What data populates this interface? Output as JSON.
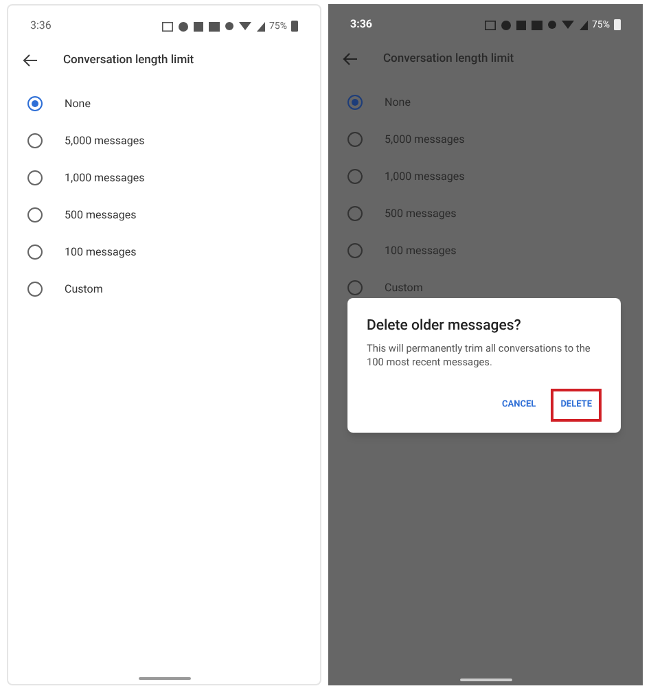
{
  "screens": [
    {
      "dimmed": false,
      "status_bar": {
        "time": "3:36",
        "battery": "75%"
      },
      "title": "Conversation length limit",
      "options": [
        {
          "label": "None",
          "selected": true
        },
        {
          "label": "5,000 messages",
          "selected": false
        },
        {
          "label": "1,000 messages",
          "selected": false
        },
        {
          "label": "500 messages",
          "selected": false
        },
        {
          "label": "100 messages",
          "selected": false
        },
        {
          "label": "Custom",
          "selected": false
        }
      ]
    },
    {
      "dimmed": true,
      "status_bar": {
        "time": "3:36",
        "battery": "75%"
      },
      "title": "Conversation length limit",
      "options": [
        {
          "label": "None",
          "selected": true
        },
        {
          "label": "5,000 messages",
          "selected": false
        },
        {
          "label": "1,000 messages",
          "selected": false
        },
        {
          "label": "500 messages",
          "selected": false
        },
        {
          "label": "100 messages",
          "selected": false
        },
        {
          "label": "Custom",
          "selected": false
        }
      ],
      "dialog": {
        "title": "Delete older messages?",
        "message": "This will permanently trim all conversations to the 100 most recent messages.",
        "buttons": [
          {
            "label": "CANCEL",
            "highlighted": false
          },
          {
            "label": "DELETE",
            "highlighted": true
          }
        ]
      }
    }
  ]
}
